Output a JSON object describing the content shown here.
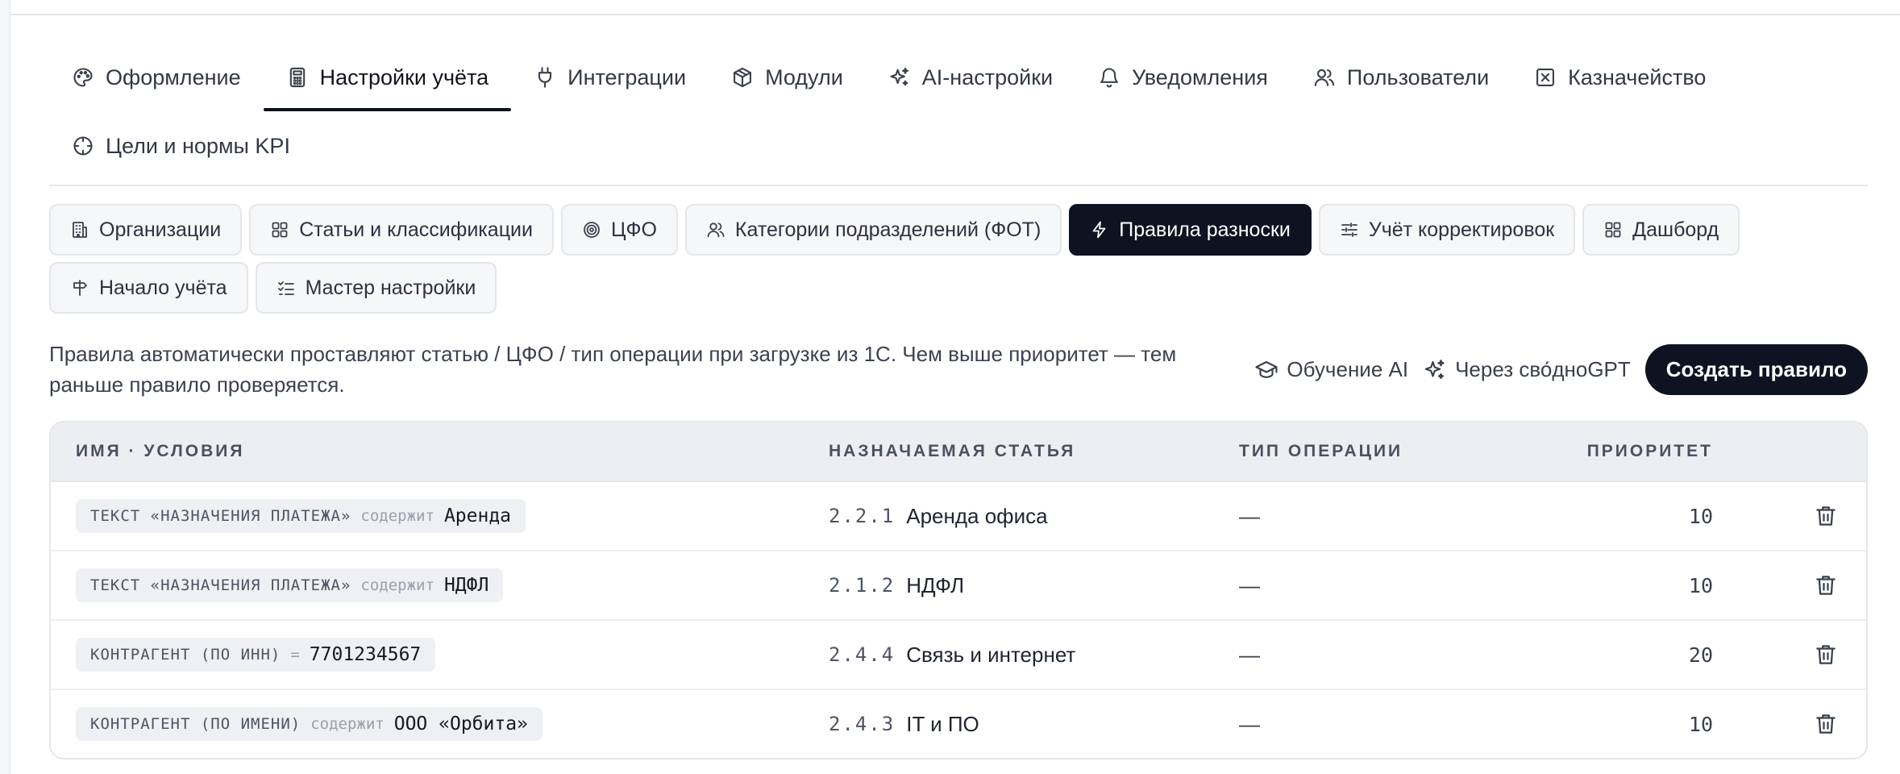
{
  "main_tabs": [
    {
      "label": "Оформление",
      "icon": "palette-icon"
    },
    {
      "label": "Настройки учёта",
      "icon": "calculator-icon",
      "active": true
    },
    {
      "label": "Интеграции",
      "icon": "plug-icon"
    },
    {
      "label": "Модули",
      "icon": "package-icon"
    },
    {
      "label": "AI-настройки",
      "icon": "sparkles-icon"
    },
    {
      "label": "Уведомления",
      "icon": "bell-icon"
    },
    {
      "label": "Пользователи",
      "icon": "users-icon"
    },
    {
      "label": "Казначейство",
      "icon": "square-x-icon"
    },
    {
      "label": "Цели и нормы KPI",
      "icon": "crosshair-icon"
    }
  ],
  "sub_tabs": [
    {
      "label": "Организации",
      "icon": "building-icon"
    },
    {
      "label": "Статьи и классификации",
      "icon": "grid-icon"
    },
    {
      "label": "ЦФО",
      "icon": "target-icon"
    },
    {
      "label": "Категории подразделений (ФОТ)",
      "icon": "users-icon"
    },
    {
      "label": "Правила разноски",
      "icon": "lightning-icon",
      "active": true
    },
    {
      "label": "Учёт корректировок",
      "icon": "sliders-icon"
    },
    {
      "label": "Дашборд",
      "icon": "grid-icon"
    },
    {
      "label": "Начало учёта",
      "icon": "signpost-icon"
    },
    {
      "label": "Мастер настройки",
      "icon": "checklist-icon"
    }
  ],
  "description": "Правила автоматически проставляют статью / ЦФО / тип операции при загрузке из 1С. Чем выше приоритет — тем раньше правило проверяется.",
  "actions": {
    "learn_ai": "Обучение AI",
    "via_gpt": "Через сво́дноGPT",
    "create_rule": "Создать правило"
  },
  "table": {
    "headers": {
      "name": "ИМЯ · УСЛОВИЯ",
      "article": "НАЗНАЧАЕМАЯ СТАТЬЯ",
      "optype": "ТИП ОПЕРАЦИИ",
      "priority": "ПРИОРИТЕТ"
    },
    "rows": [
      {
        "field": "ТЕКСТ «НАЗНАЧЕНИЯ ПЛАТЕЖА»",
        "op": "содержит",
        "value": "Аренда",
        "article_code": "2.2.1",
        "article_name": "Аренда офиса",
        "optype": "—",
        "priority": "10"
      },
      {
        "field": "ТЕКСТ «НАЗНАЧЕНИЯ ПЛАТЕЖА»",
        "op": "содержит",
        "value": "НДФЛ",
        "article_code": "2.1.2",
        "article_name": "НДФЛ",
        "optype": "—",
        "priority": "10"
      },
      {
        "field": "КОНТРАГЕНТ (ПО ИНН)",
        "op": "=",
        "value": "7701234567",
        "article_code": "2.4.4",
        "article_name": "Связь и интернет",
        "optype": "—",
        "priority": "20"
      },
      {
        "field": "КОНТРАГЕНТ (ПО ИМЕНИ)",
        "op": "содержит",
        "value": "ООО «Орбита»",
        "article_code": "2.4.3",
        "article_name": "IT и ПО",
        "optype": "—",
        "priority": "10"
      }
    ]
  },
  "colors": {
    "accent": "#0d1320",
    "background": "#ffffff",
    "table_header": "#eceef1"
  }
}
